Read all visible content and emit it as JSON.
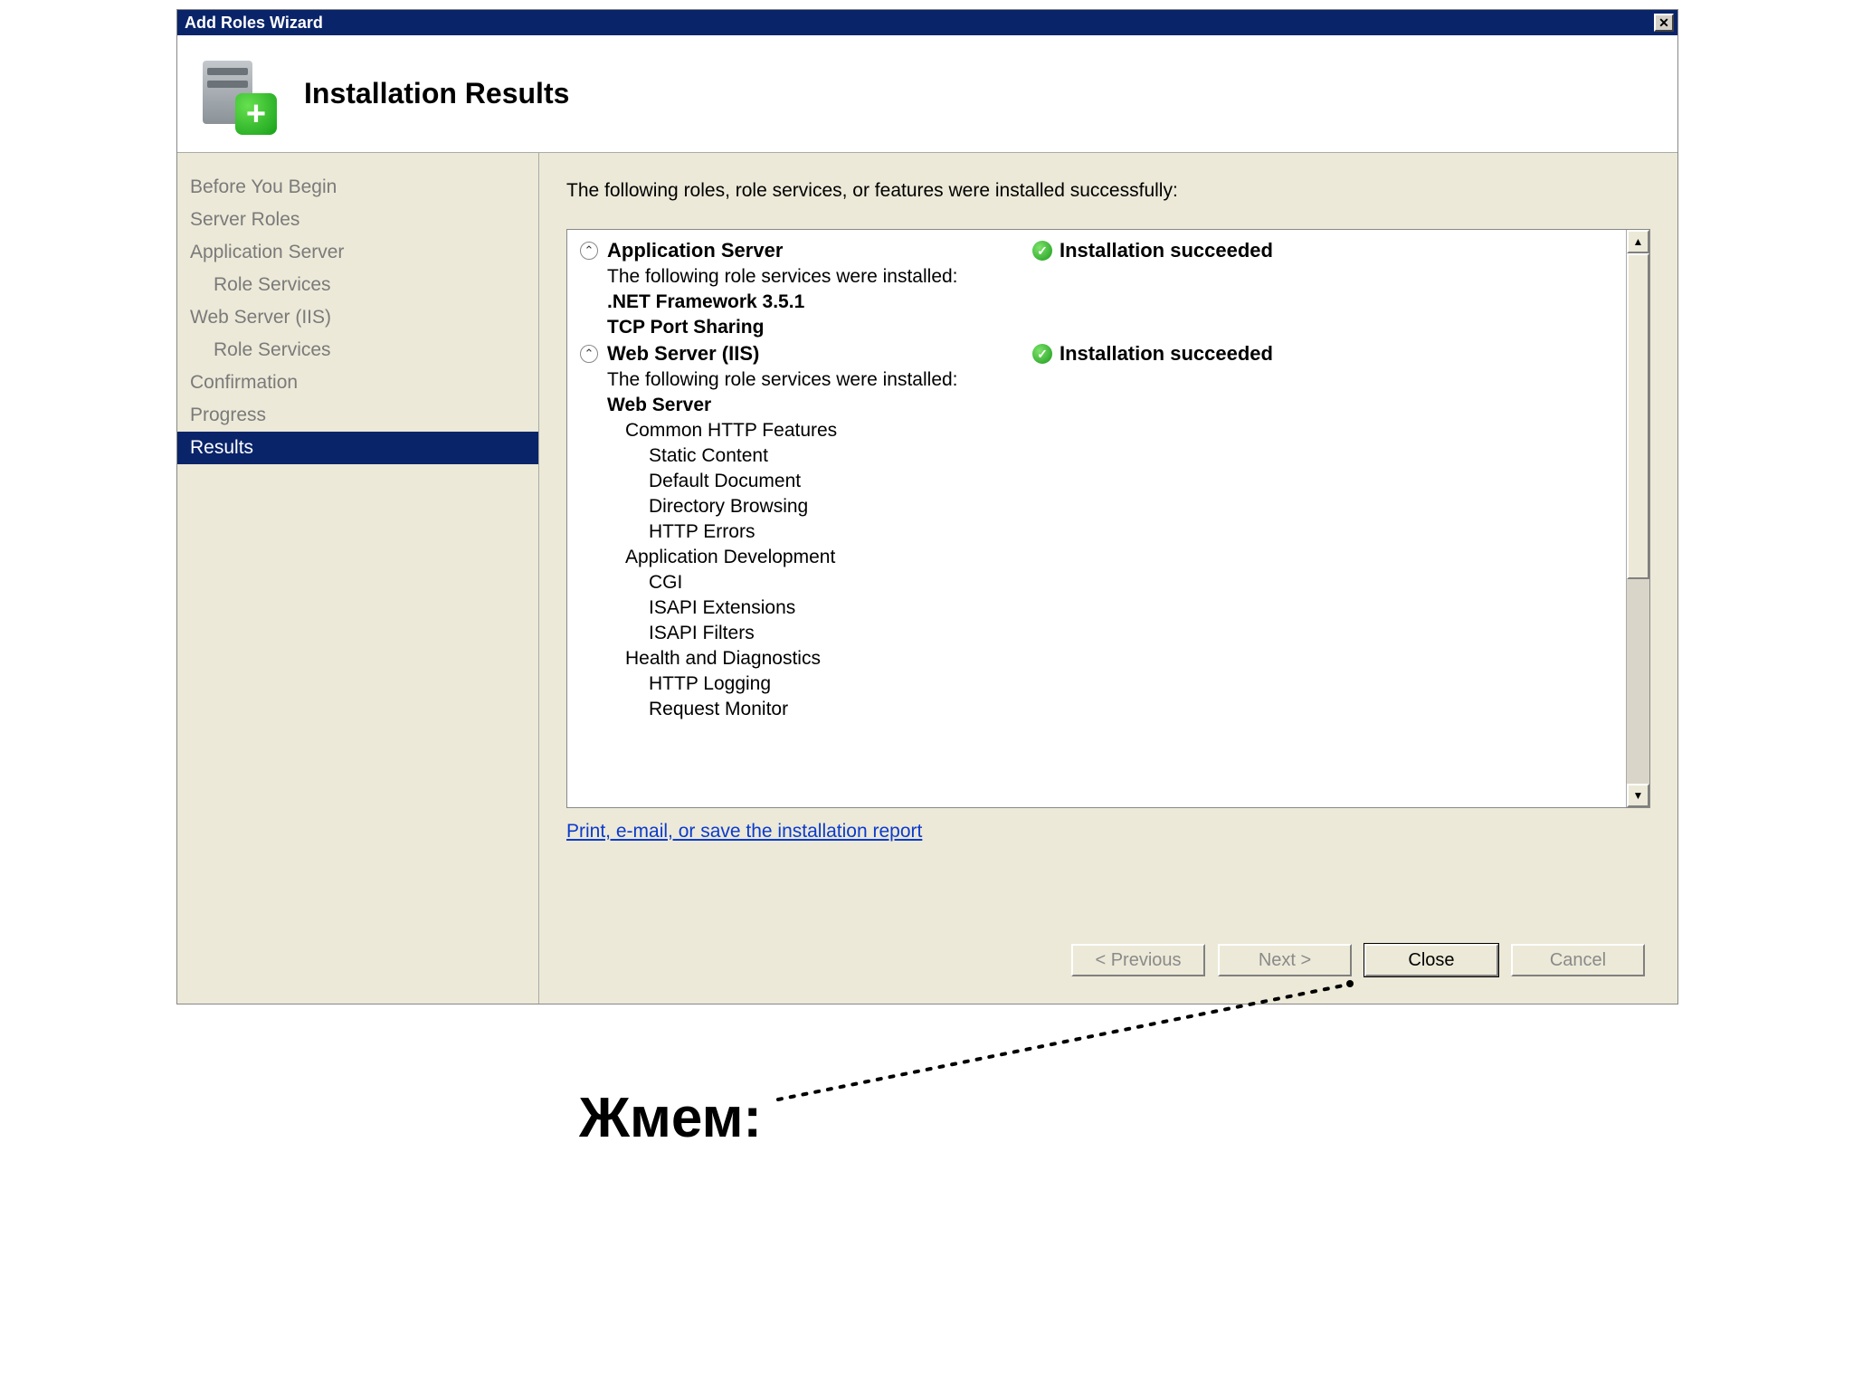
{
  "window": {
    "title": "Add Roles Wizard",
    "close_symbol": "✕"
  },
  "header": {
    "title": "Installation Results",
    "plus": "+"
  },
  "sidebar": {
    "items": [
      {
        "label": "Before You Begin",
        "sub": false
      },
      {
        "label": "Server Roles",
        "sub": false
      },
      {
        "label": "Application Server",
        "sub": false
      },
      {
        "label": "Role Services",
        "sub": true
      },
      {
        "label": "Web Server (IIS)",
        "sub": false
      },
      {
        "label": "Role Services",
        "sub": true
      },
      {
        "label": "Confirmation",
        "sub": false
      },
      {
        "label": "Progress",
        "sub": false
      },
      {
        "label": "Results",
        "sub": false,
        "active": true
      }
    ]
  },
  "content": {
    "intro": "The following roles, role services, or features were installed successfully:",
    "chevron": "⌃",
    "check": "✓",
    "roles": [
      {
        "name": "Application Server",
        "status": "Installation succeeded",
        "lead": "The following role services were installed:",
        "lines": [
          {
            "text": ".NET Framework 3.5.1",
            "bold": true,
            "lvl": 0
          },
          {
            "text": "TCP Port Sharing",
            "bold": true,
            "lvl": 0
          }
        ]
      },
      {
        "name": "Web Server (IIS)",
        "status": "Installation succeeded",
        "lead": "The following role services were installed:",
        "lines": [
          {
            "text": "Web Server",
            "bold": true,
            "lvl": 0
          },
          {
            "text": "Common HTTP Features",
            "bold": false,
            "lvl": 1
          },
          {
            "text": "Static Content",
            "bold": false,
            "lvl": 2
          },
          {
            "text": "Default Document",
            "bold": false,
            "lvl": 2
          },
          {
            "text": "Directory Browsing",
            "bold": false,
            "lvl": 2
          },
          {
            "text": "HTTP Errors",
            "bold": false,
            "lvl": 2
          },
          {
            "text": "Application Development",
            "bold": false,
            "lvl": 1
          },
          {
            "text": "CGI",
            "bold": false,
            "lvl": 2
          },
          {
            "text": "ISAPI Extensions",
            "bold": false,
            "lvl": 2
          },
          {
            "text": "ISAPI Filters",
            "bold": false,
            "lvl": 2
          },
          {
            "text": "Health and Diagnostics",
            "bold": false,
            "lvl": 1
          },
          {
            "text": "HTTP Logging",
            "bold": false,
            "lvl": 2
          },
          {
            "text": "Request Monitor",
            "bold": false,
            "lvl": 2
          }
        ]
      }
    ],
    "report_link": "Print, e-mail, or save the installation report",
    "scroll_up": "▲",
    "scroll_down": "▼"
  },
  "buttons": {
    "previous": "< Previous",
    "next": "Next >",
    "close": "Close",
    "cancel": "Cancel"
  },
  "annotation": {
    "text": "Жмем:"
  }
}
